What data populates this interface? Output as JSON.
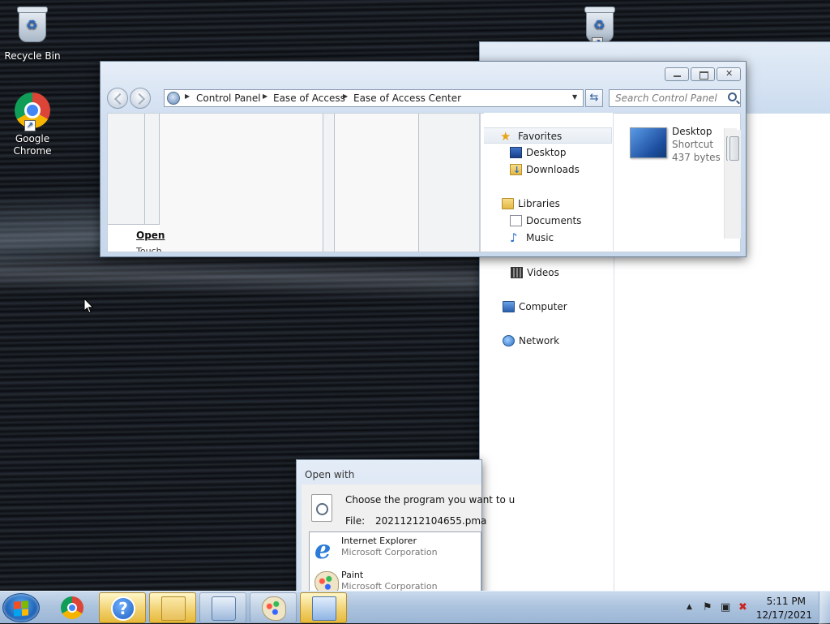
{
  "desktop": {
    "icons": [
      {
        "label": "Recycle Bin"
      },
      {
        "label": "Google Chrome"
      }
    ]
  },
  "back_window": {
    "nav": {
      "favorites": "Favorites",
      "desktop": "Desktop",
      "downloads": "Downloads",
      "libraries": "Libraries",
      "documents": "Documents",
      "music": "Music",
      "videos": "Videos",
      "computer": "Computer",
      "network": "Network"
    },
    "file": {
      "name": "Desktop",
      "type": "Shortcut",
      "size": "437 bytes"
    }
  },
  "front_window": {
    "breadcrumb": [
      "Control Panel",
      "Ease of Access",
      "Ease of Access Center"
    ],
    "search_placeholder": "Search Control Panel",
    "open_label": "Open",
    "open_sub": "Touch"
  },
  "open_with": {
    "title": "Open with",
    "prompt": "Choose the program you want to u",
    "file_label": "File:",
    "file_name": "20211212104655.pma",
    "programs": [
      {
        "name": "Internet Explorer",
        "company": "Microsoft Corporation"
      },
      {
        "name": "Paint",
        "company": "Microsoft Corporation"
      }
    ]
  },
  "taskbar": {
    "time": "5:11 PM",
    "date": "12/17/2021",
    "help_glyph": "?"
  },
  "colors": {
    "accent": "#1a5fb4",
    "taskbar": "#adc4de",
    "active_task": "#f1cf6b"
  }
}
